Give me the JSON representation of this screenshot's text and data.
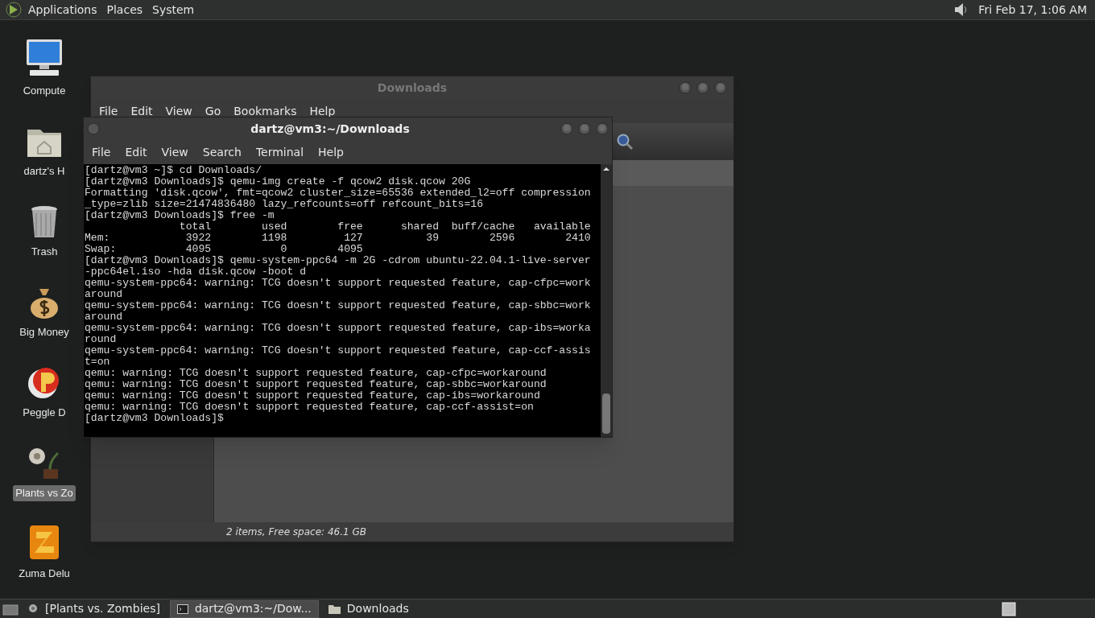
{
  "top_panel": {
    "menus": [
      "Applications",
      "Places",
      "System"
    ],
    "clock": "Fri Feb 17, 1:06 AM"
  },
  "desktop_icons": [
    {
      "kind": "computer",
      "label": "Compute",
      "selected": false
    },
    {
      "kind": "home",
      "label": "dartz's H",
      "selected": false
    },
    {
      "kind": "trash",
      "label": "Trash",
      "selected": false
    },
    {
      "kind": "money",
      "label": "Big Money",
      "selected": false
    },
    {
      "kind": "peggle",
      "label": "Peggle D",
      "selected": false
    },
    {
      "kind": "plants",
      "label": "Plants vs Zo",
      "selected": true
    },
    {
      "kind": "zuma",
      "label": "Zuma Delu",
      "selected": false
    }
  ],
  "file_manager": {
    "title": "Downloads",
    "menu": [
      "File",
      "Edit",
      "View",
      "Go",
      "Bookmarks",
      "Help"
    ],
    "status": "2 items, Free space: 46.1 GB"
  },
  "terminal": {
    "title": "dartz@vm3:~/Downloads",
    "menu": [
      "File",
      "Edit",
      "View",
      "Search",
      "Terminal",
      "Help"
    ],
    "lines": [
      "[dartz@vm3 ~]$ cd Downloads/",
      "[dartz@vm3 Downloads]$ qemu-img create -f qcow2 disk.qcow 20G",
      "Formatting 'disk.qcow', fmt=qcow2 cluster_size=65536 extended_l2=off compression",
      "_type=zlib size=21474836480 lazy_refcounts=off refcount_bits=16",
      "[dartz@vm3 Downloads]$ free -m",
      "               total        used        free      shared  buff/cache   available",
      "Mem:            3922        1198         127          39        2596        2410",
      "Swap:           4095           0        4095",
      "[dartz@vm3 Downloads]$ qemu-system-ppc64 -m 2G -cdrom ubuntu-22.04.1-live-server",
      "-ppc64el.iso -hda disk.qcow -boot d",
      "qemu-system-ppc64: warning: TCG doesn't support requested feature, cap-cfpc=work",
      "around",
      "qemu-system-ppc64: warning: TCG doesn't support requested feature, cap-sbbc=work",
      "around",
      "qemu-system-ppc64: warning: TCG doesn't support requested feature, cap-ibs=worka",
      "round",
      "qemu-system-ppc64: warning: TCG doesn't support requested feature, cap-ccf-assis",
      "t=on",
      "qemu: warning: TCG doesn't support requested feature, cap-cfpc=workaround",
      "qemu: warning: TCG doesn't support requested feature, cap-sbbc=workaround",
      "qemu: warning: TCG doesn't support requested feature, cap-ibs=workaround",
      "qemu: warning: TCG doesn't support requested feature, cap-ccf-assist=on",
      "[dartz@vm3 Downloads]$"
    ]
  },
  "taskbar": {
    "buttons": [
      {
        "kind": "plants",
        "label": "[Plants vs. Zombies]",
        "selected": false
      },
      {
        "kind": "terminal",
        "label": "dartz@vm3:~/Dow...",
        "selected": true
      },
      {
        "kind": "folder",
        "label": "Downloads",
        "selected": false
      }
    ]
  }
}
